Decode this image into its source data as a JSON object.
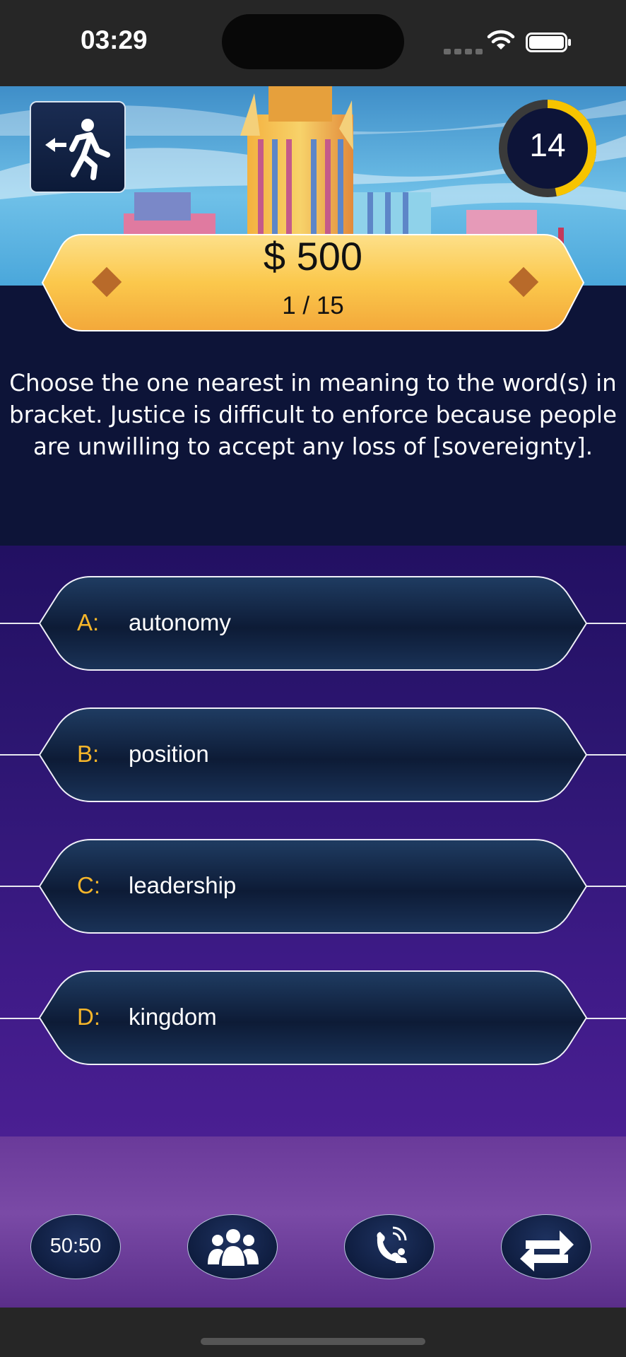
{
  "status_bar": {
    "time": "03:29"
  },
  "game": {
    "timer_seconds": "14",
    "timer_fraction": 0.47,
    "prize": "$ 500",
    "question_counter": "1 / 15",
    "question": "Choose the one nearest in meaning to the word(s) in bracket. Justice is difficult to enforce because people are unwilling to accept any loss of [sovereignty]."
  },
  "answers": [
    {
      "letter": "A:",
      "text": "autonomy"
    },
    {
      "letter": "B:",
      "text": "position"
    },
    {
      "letter": "C:",
      "text": "leadership"
    },
    {
      "letter": "D:",
      "text": "kingdom"
    }
  ],
  "lifelines": {
    "fifty_fifty": "50:50",
    "audience_icon": "audience-icon",
    "phone_icon": "phone-friend-icon",
    "switch_icon": "switch-question-icon"
  },
  "colors": {
    "answer_letter": "#f5b52a",
    "timer_ring": "#f7c400",
    "banner": "#fbc44a"
  }
}
